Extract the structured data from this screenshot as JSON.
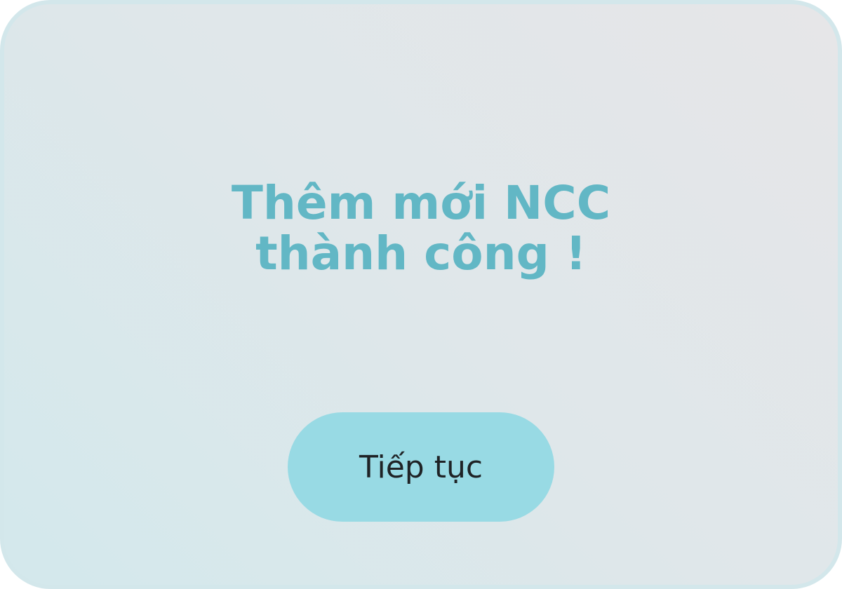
{
  "dialog": {
    "title_line1": "Thêm mới NCC",
    "title_line2": "thành công !",
    "continue_label": "Tiếp tục"
  },
  "colors": {
    "title": "#62b7c5",
    "button_bg": "#98dae4",
    "button_text": "#1f2326",
    "dialog_border": "#d3e7eb"
  }
}
